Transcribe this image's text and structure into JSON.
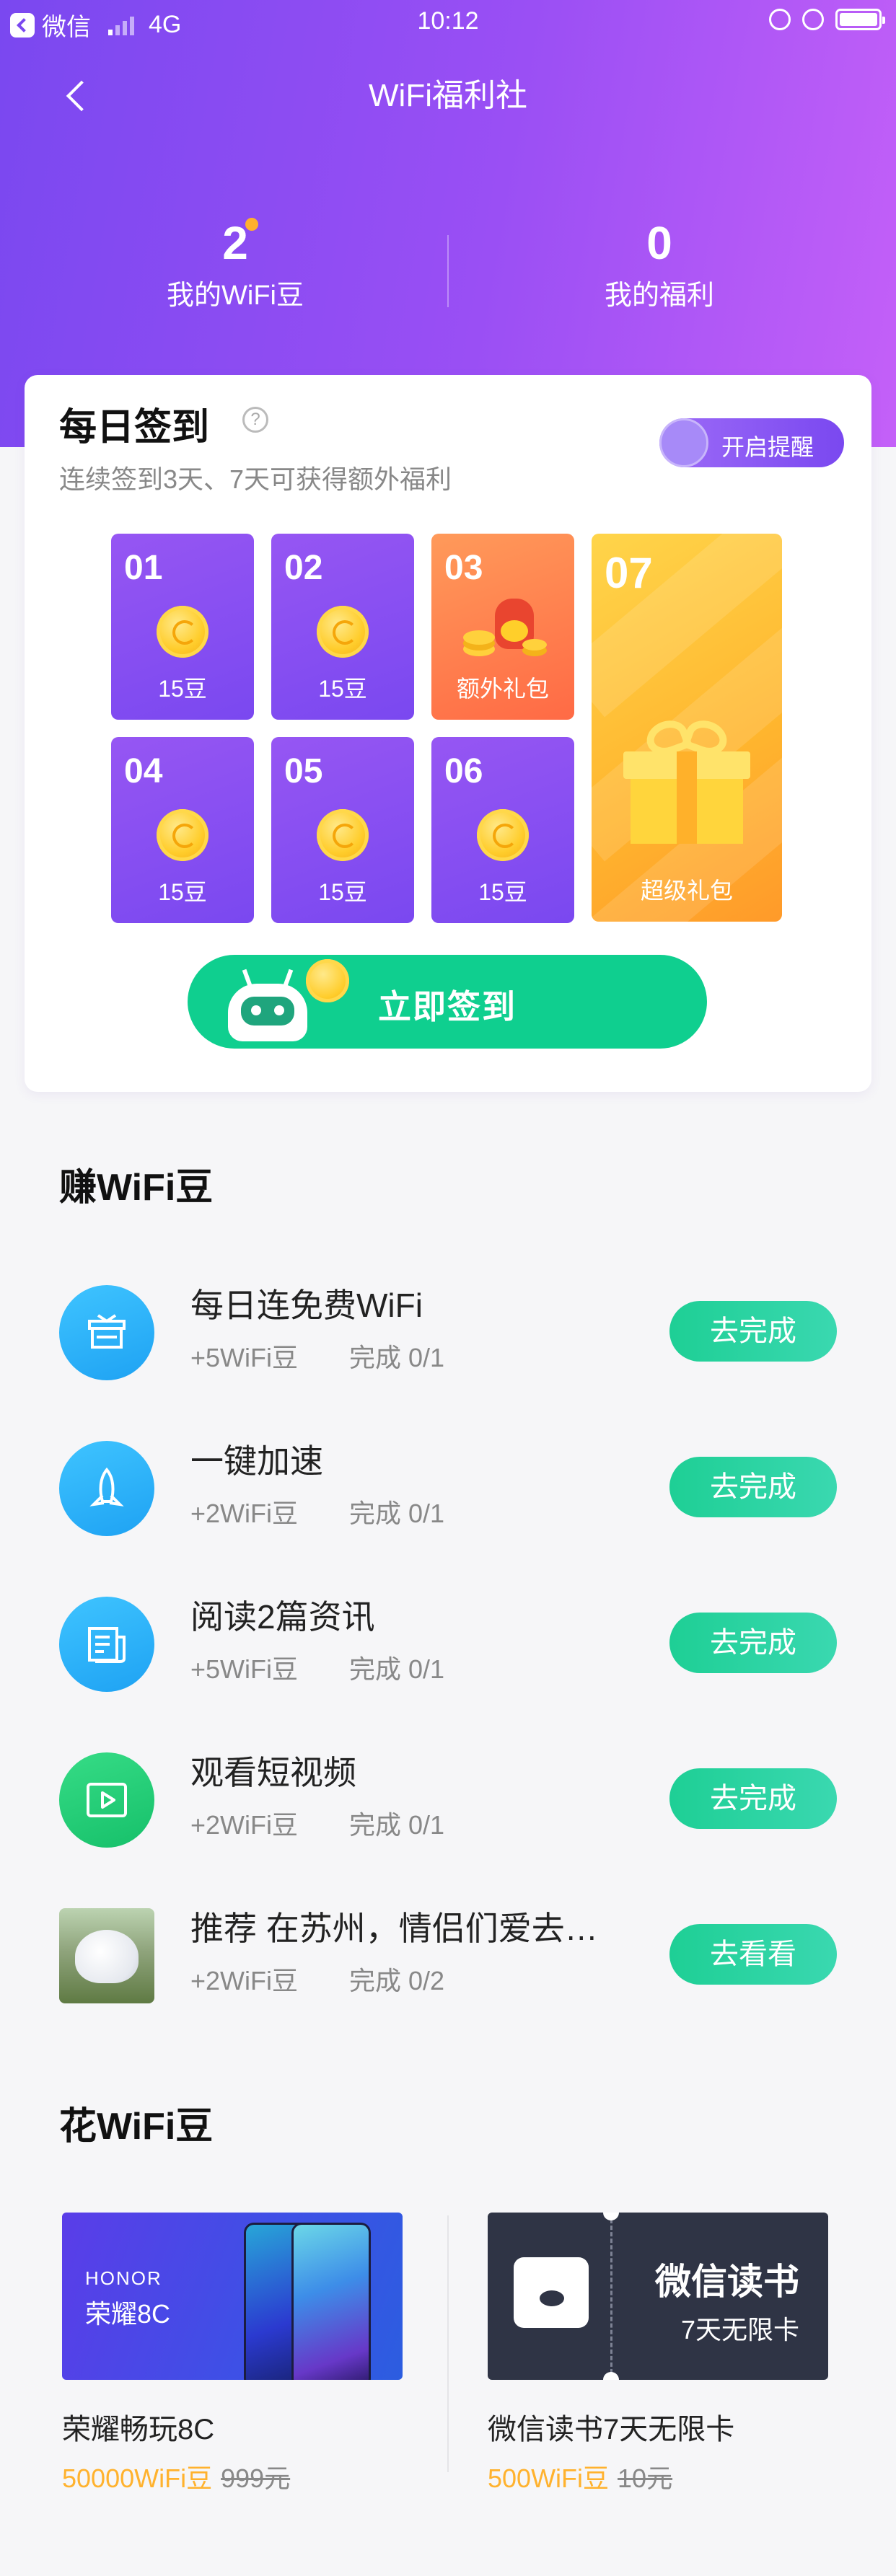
{
  "status_bar": {
    "carrier": "微信",
    "network": "4G",
    "time": "10:12"
  },
  "nav": {
    "title": "WiFi福利社"
  },
  "stats": [
    {
      "value": "2",
      "label": "我的WiFi豆"
    },
    {
      "value": "0",
      "label": "我的福利"
    }
  ],
  "checkin": {
    "title": "每日签到",
    "help_glyph": "?",
    "subtitle": "连续签到3天、7天可获得额外福利",
    "remind_label": "开启提醒",
    "days": [
      {
        "num": "01",
        "label": "15豆"
      },
      {
        "num": "02",
        "label": "15豆"
      },
      {
        "num": "03",
        "label": "额外礼包"
      },
      {
        "num": "04",
        "label": "15豆"
      },
      {
        "num": "05",
        "label": "15豆"
      },
      {
        "num": "06",
        "label": "15豆"
      },
      {
        "num": "07",
        "label": "超级礼包"
      }
    ],
    "button_label": "立即签到"
  },
  "earn": {
    "title": "赚WiFi豆",
    "tasks": [
      {
        "name": "每日连免费WiFi",
        "reward": "+5WiFi豆",
        "progress": "完成 0/1",
        "button": "去完成",
        "icon": "gift-box-icon"
      },
      {
        "name": "一键加速",
        "reward": "+2WiFi豆",
        "progress": "完成 0/1",
        "button": "去完成",
        "icon": "rocket-icon"
      },
      {
        "name": "阅读2篇资讯",
        "reward": "+5WiFi豆",
        "progress": "完成 0/1",
        "button": "去完成",
        "icon": "news-icon"
      },
      {
        "name": "观看短视频",
        "reward": "+2WiFi豆",
        "progress": "完成 0/1",
        "button": "去完成",
        "icon": "play-icon"
      },
      {
        "name": " 推荐 在苏州，情侣们爱去…",
        "reward": "+2WiFi豆",
        "progress": "完成 0/2",
        "button": "去看看",
        "icon": "bubble-house-thumbnail"
      }
    ]
  },
  "spend": {
    "title": "花WiFi豆",
    "products": [
      {
        "brand": "HONOR",
        "model": "荣耀8C",
        "name": "荣耀畅玩8C",
        "cost": "50000WiFi豆",
        "original_price": "999元"
      },
      {
        "banner_title": "微信读书",
        "banner_sub": "7天无限卡",
        "name": "微信读书7天无限卡",
        "cost": "500WiFi豆",
        "original_price": "10元"
      }
    ]
  },
  "colors": {
    "primary_purple": "#7a48f0",
    "accent_green": "#0fcf8f",
    "coin_gold": "#ffcd2c",
    "price_orange": "#ffb22e"
  }
}
